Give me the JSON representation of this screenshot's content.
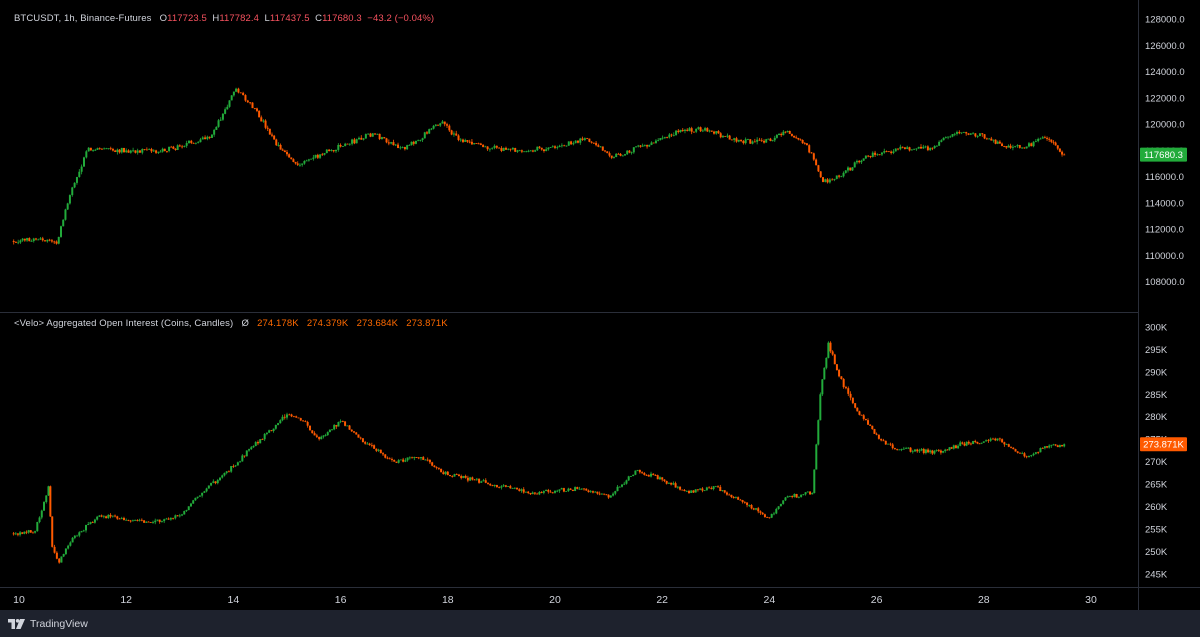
{
  "header": {
    "symbol": "BTCUSDT, 1h, Binance-Futures",
    "o_label": "O",
    "o_value": "117723.5",
    "h_label": "H",
    "h_value": "117782.4",
    "l_label": "L",
    "l_value": "117437.5",
    "c_label": "C",
    "c_value": "117680.3",
    "change": "−43.2 (−0.04%)"
  },
  "oi_header": {
    "title": "<Velo> Aggregated Open Interest (Coins, Candles)",
    "symbol_glyph": "Ø",
    "values": [
      "274.178K",
      "274.379K",
      "273.684K",
      "273.871K"
    ]
  },
  "brand": {
    "name": "TradingView"
  },
  "colors": {
    "background": "#000000",
    "frame": "#1e222d",
    "up": "#22ab3b",
    "down": "#ff5a00",
    "price_label_bg": "#22ab3b",
    "oi_label_bg": "#ff5a00",
    "axis_text": "#d1d4dc"
  },
  "chart_data": [
    {
      "type": "candlestick",
      "name": "price",
      "title": "BTCUSDT, 1h, Binance-Futures",
      "y_ticks": [
        108000,
        110000,
        112000,
        114000,
        116000,
        118000,
        120000,
        122000,
        124000,
        126000,
        128000
      ],
      "y_tick_labels": [
        "108000.0",
        "110000.0",
        "112000.0",
        "114000.0",
        "116000.0",
        "118000.0",
        "120000.0",
        "122000.0",
        "124000.0",
        "126000.0",
        "128000.0"
      ],
      "ylim": [
        106000,
        129000
      ],
      "last_value": 117680.3,
      "last_label": "117680.3",
      "x": [
        9.86,
        10.4,
        10.7,
        10.95,
        11.3,
        12.0,
        12.6,
        13.0,
        13.6,
        14.05,
        14.4,
        14.8,
        15.2,
        15.7,
        16.0,
        16.6,
        17.2,
        17.9,
        18.2,
        18.7,
        19.3,
        20.0,
        20.6,
        21.1,
        21.8,
        22.3,
        22.8,
        23.3,
        23.9,
        24.3,
        24.7,
        25.0,
        25.3,
        25.8,
        26.4,
        27.0,
        27.5,
        27.8,
        28.1,
        28.5,
        28.8,
        29.1,
        29.3,
        29.5
      ],
      "close": [
        111100,
        111300,
        110900,
        114600,
        118200,
        118000,
        117900,
        118300,
        119200,
        122700,
        121200,
        118400,
        116900,
        117800,
        118300,
        119300,
        118100,
        120200,
        118800,
        118300,
        118000,
        118200,
        118900,
        117500,
        118600,
        119400,
        119700,
        118800,
        118600,
        119400,
        118400,
        115600,
        116000,
        117600,
        118100,
        118200,
        119400,
        119300,
        118900,
        118200,
        118300,
        119000,
        118600,
        117680
      ]
    },
    {
      "type": "candlestick",
      "name": "open-interest",
      "title": "<Velo> Aggregated Open Interest (Coins, Candles)",
      "y_ticks": [
        245000,
        250000,
        255000,
        260000,
        265000,
        270000,
        275000,
        280000,
        285000,
        290000,
        295000,
        300000
      ],
      "y_tick_labels": [
        "245K",
        "250K",
        "255K",
        "260K",
        "265K",
        "270K",
        "275K",
        "280K",
        "285K",
        "290K",
        "295K",
        "300K"
      ],
      "ylim": [
        242500,
        302000
      ],
      "last_value": 273871,
      "last_label": "273.871K",
      "x": [
        9.86,
        10.3,
        10.55,
        10.62,
        10.75,
        11.0,
        11.5,
        12.0,
        12.5,
        13.0,
        13.5,
        14.0,
        14.5,
        15.0,
        15.3,
        15.6,
        16.0,
        16.5,
        17.0,
        17.5,
        18.0,
        18.5,
        19.0,
        19.5,
        20.0,
        20.5,
        21.0,
        21.5,
        22.0,
        22.5,
        23.0,
        23.5,
        24.0,
        24.3,
        24.8,
        24.95,
        25.1,
        25.3,
        25.6,
        26.0,
        26.3,
        26.8,
        27.2,
        27.6,
        28.0,
        28.3,
        28.8,
        29.1,
        29.5
      ],
      "close": [
        254000,
        254500,
        264500,
        251000,
        247500,
        253000,
        258000,
        257000,
        256500,
        258000,
        264000,
        269000,
        275000,
        280500,
        279000,
        275000,
        279000,
        274000,
        270000,
        271000,
        267000,
        266000,
        264500,
        263000,
        263500,
        264000,
        262000,
        268000,
        266000,
        263000,
        264500,
        261000,
        257500,
        262000,
        263000,
        285000,
        296500,
        289000,
        282000,
        276000,
        273000,
        272500,
        272000,
        274000,
        274500,
        275000,
        271000,
        273000,
        273871
      ]
    }
  ],
  "x_axis": {
    "ticks": [
      10,
      12,
      14,
      16,
      18,
      20,
      22,
      24,
      26,
      28,
      30
    ],
    "tick_labels": [
      "10",
      "12",
      "14",
      "16",
      "18",
      "20",
      "22",
      "24",
      "26",
      "28",
      "30"
    ]
  }
}
